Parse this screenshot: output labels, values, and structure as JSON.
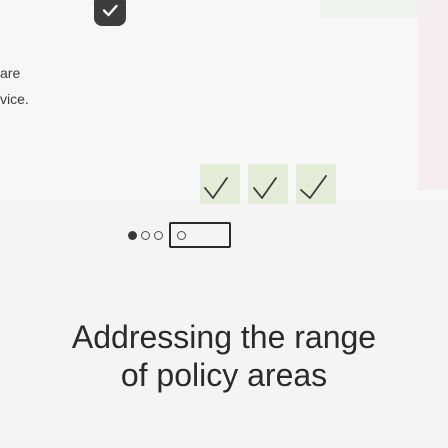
{
  "intro_text": {
    "line1": "are",
    "line2": "vice."
  },
  "icons": {
    "badge": "check-badge-icon",
    "checks": [
      "check-icon",
      "check-icon",
      "check-icon"
    ]
  },
  "carousel": {
    "total_dots": 4,
    "active_index": 0
  },
  "headline": {
    "line1": "Addressing the range",
    "line2": "of policy areas"
  },
  "colors": {
    "check_tile": "#e3ecd7",
    "badge": "#3d3d3d",
    "text": "#2a2a2a"
  }
}
